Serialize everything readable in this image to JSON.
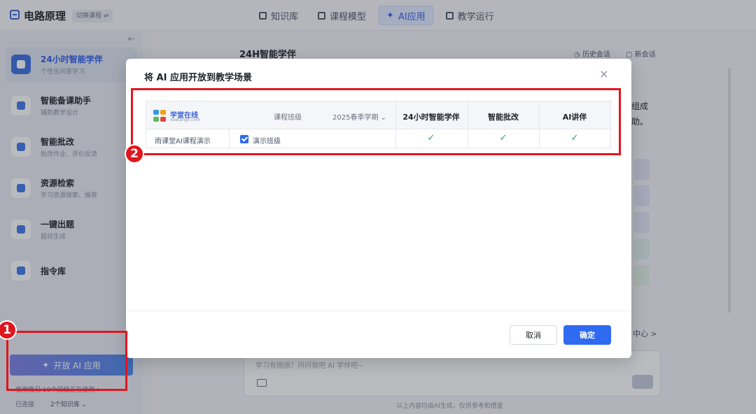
{
  "header": {
    "app_title": "电路原理",
    "switch_course": "切换课程 ⇌",
    "nav": [
      {
        "label": "知识库",
        "icon": "book-icon"
      },
      {
        "label": "课程模型",
        "icon": "network-icon"
      },
      {
        "label": "AI应用",
        "icon": "sparkle-icon",
        "active": true
      },
      {
        "label": "教学运行",
        "icon": "grid-icon"
      }
    ]
  },
  "sidebar": {
    "items": [
      {
        "title": "24小时智能学伴",
        "subtitle": "个性化问答学习",
        "active": true
      },
      {
        "title": "智能备课助手",
        "subtitle": "辅助教学设计"
      },
      {
        "title": "智能批改",
        "subtitle": "批改作业、评价反馈"
      },
      {
        "title": "资源检索",
        "subtitle": "学习资源搜索、推荐"
      },
      {
        "title": "一键出题",
        "subtitle": "题目生成"
      },
      {
        "title": "指令库",
        "subtitle": ""
      }
    ],
    "open_ai_button": "开放 AI 应用",
    "usage_text": "使用情况  18个班级正在使用 >",
    "status": "已连接",
    "kb_count": "2个知识库"
  },
  "main": {
    "chat_title": "24H智能学伴",
    "history_link": "历史会话",
    "new_chat_link": "新会话",
    "right_text": "组成\n助。",
    "center_link": "中心 >",
    "input_placeholder": "学习有困惑？问问我吧 AI 学伴吧~",
    "disclaimer": "以上内容均由AI生成，仅供参考和借鉴"
  },
  "modal": {
    "title": "将 AI 应用开放到教学场景",
    "close_label": "×",
    "platform_name": "学堂在线",
    "platform_url": "xuetangx.com",
    "class_column_label": "课程班级",
    "term_select": "2025春季学期",
    "app_columns": [
      "24小时智能学伴",
      "智能批改",
      "AI讲伴"
    ],
    "rows": [
      {
        "course": "雨课堂AI课程演示",
        "class_name": "演示班级",
        "checked": true,
        "enabled": [
          "✓",
          "✓",
          "✓"
        ]
      }
    ],
    "cancel_label": "取消",
    "confirm_label": "确定"
  },
  "annotations": [
    "1",
    "2"
  ],
  "colors": {
    "accent": "#2f6bf0",
    "annotation_red": "#e0161e",
    "check_green": "#2fa35c"
  }
}
